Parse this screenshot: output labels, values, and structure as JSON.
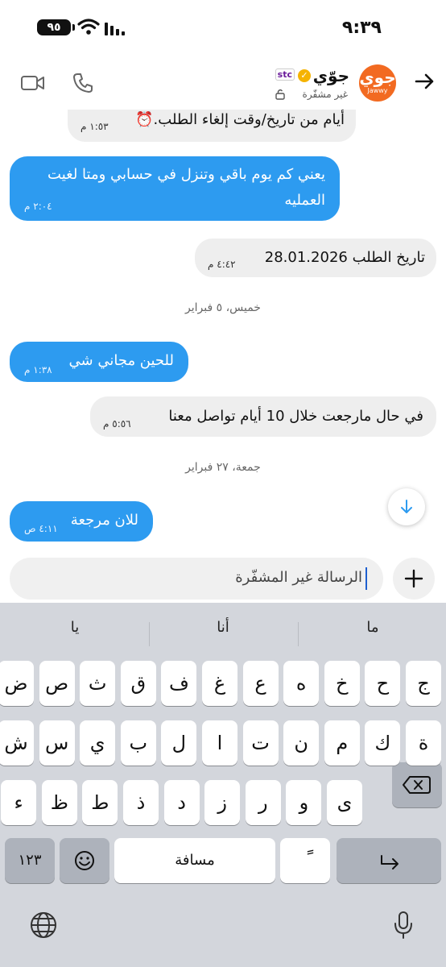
{
  "status_bar": {
    "time": "٩:٣٩",
    "battery": "٩٥"
  },
  "header": {
    "contact_name": "جوّي",
    "carrier_badge": "stc",
    "encryption_status": "غير مشفّرة",
    "avatar_logo": "جوي",
    "avatar_logo_sub": "Jawwy"
  },
  "messages": [
    {
      "direction": "incoming",
      "text": "أيام من تاريخ/وقت إلغاء الطلب.⏰",
      "time": "١:٥٣ م"
    },
    {
      "direction": "outgoing",
      "lines": [
        "يعني كم يوم باقي وتنزل في حسابي ومتا لغيت",
        "العمليه"
      ],
      "time": "٢:٠٤ م"
    },
    {
      "direction": "incoming",
      "text": "تاريخ الطلب 28.01.2026",
      "time": "٤:٤٢ م"
    },
    {
      "direction": "date",
      "text": "خميس، ٥ فبراير"
    },
    {
      "direction": "outgoing",
      "text": "للحين مجاني شي",
      "time": "١:٣٨ م"
    },
    {
      "direction": "incoming",
      "text": "في حال مارجعت خلال 10 أيام تواصل معنا",
      "time": "٥:٥٦ م"
    },
    {
      "direction": "date",
      "text": "جمعة، ٢٧ فبراير"
    },
    {
      "direction": "outgoing",
      "text": "للان مرجعة",
      "time": "٤:١١ ص"
    }
  ],
  "composer": {
    "placeholder": "الرسالة غير المشفّرة"
  },
  "keyboard": {
    "suggestions": [
      "ما",
      "أنا",
      "يا"
    ],
    "row1": [
      "ج",
      "ح",
      "خ",
      "ه",
      "ع",
      "غ",
      "ف",
      "ق",
      "ث",
      "ص",
      "ض"
    ],
    "row2": [
      "ة",
      "ك",
      "م",
      "ن",
      "ت",
      "ا",
      "ل",
      "ب",
      "ي",
      "س",
      "ش"
    ],
    "row3": [
      "ى",
      "و",
      "ر",
      "ز",
      "د",
      "ذ",
      "ط",
      "ظ",
      "ء"
    ],
    "numbers_key": "١٢٣",
    "space_key": "مسافة",
    "tanween_key": "ً"
  },
  "colors": {
    "outgoing_bubble": "#2d9bf0",
    "incoming_bubble": "#eeeeee",
    "keyboard_bg": "#d3d6dc"
  }
}
